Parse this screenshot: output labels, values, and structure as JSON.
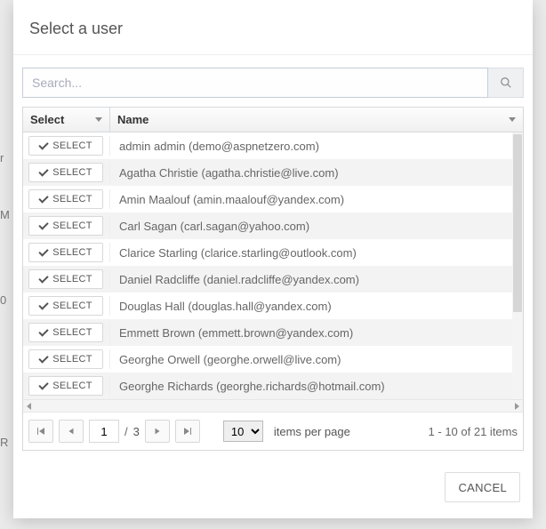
{
  "modal": {
    "title": "Select a user",
    "search_placeholder": "Search...",
    "cancel_label": "CANCEL"
  },
  "grid": {
    "col_select": "Select",
    "col_name": "Name",
    "select_btn": "SELECT",
    "rows": [
      {
        "name": "admin admin (demo@aspnetzero.com)"
      },
      {
        "name": "Agatha Christie (agatha.christie@live.com)"
      },
      {
        "name": "Amin Maalouf (amin.maalouf@yandex.com)"
      },
      {
        "name": "Carl Sagan (carl.sagan@yahoo.com)"
      },
      {
        "name": "Clarice Starling (clarice.starling@outlook.com)"
      },
      {
        "name": "Daniel Radcliffe (daniel.radcliffe@yandex.com)"
      },
      {
        "name": "Douglas Hall (douglas.hall@yandex.com)"
      },
      {
        "name": "Emmett Brown (emmett.brown@yandex.com)"
      },
      {
        "name": "Georghe Orwell (georghe.orwell@live.com)"
      },
      {
        "name": "Georghe Richards (georghe.richards@hotmail.com)"
      }
    ]
  },
  "pager": {
    "page": "1",
    "total_pages": "3",
    "page_size": "10",
    "items_per_page": "items per page",
    "range": "1 - 10 of 21 items"
  }
}
